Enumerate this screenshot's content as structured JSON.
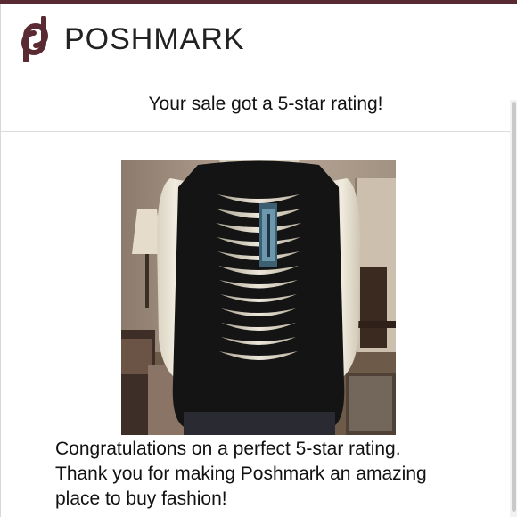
{
  "brand": {
    "name": "POSHMARK",
    "logo_icon": "poshmark-p-logo-icon",
    "color": "#5a2a33"
  },
  "email": {
    "heading": "Your sale got a 5-star rating!",
    "message_lines": [
      "Congratulations on a perfect 5-star rating.",
      "Thank you for making Poshmark an amazing",
      "place to buy fashion!"
    ]
  },
  "product_image": {
    "subject": "black sleeveless top with slashed cut-out back on mannequin"
  }
}
